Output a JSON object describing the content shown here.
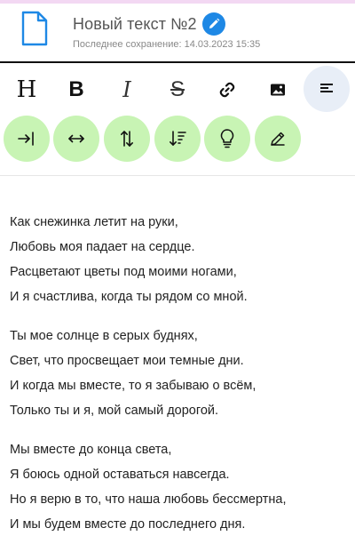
{
  "document": {
    "title": "Новый текст №2",
    "last_saved": "Последнее сохранение: 14.03.2023 15:35"
  },
  "toolbar": {
    "row1": [
      {
        "name": "heading-tool",
        "glyph": "H",
        "kind": "text"
      },
      {
        "name": "bold-tool",
        "glyph": "B",
        "kind": "text"
      },
      {
        "name": "italic-tool",
        "glyph": "I",
        "kind": "text"
      },
      {
        "name": "strikethrough-tool",
        "glyph": "S",
        "kind": "text"
      },
      {
        "name": "link-tool",
        "icon": "link-icon",
        "kind": "icon"
      },
      {
        "name": "image-tool",
        "icon": "image-icon",
        "kind": "icon"
      },
      {
        "name": "align-left-tool",
        "icon": "align-left-icon",
        "kind": "icon",
        "active": true
      }
    ],
    "row2": [
      {
        "name": "indent-tool",
        "icon": "indent-arrow-icon"
      },
      {
        "name": "letter-spacing-tool",
        "icon": "horizontal-arrows-icon"
      },
      {
        "name": "line-spacing-tool",
        "icon": "vertical-arrows-icon"
      },
      {
        "name": "sort-tool",
        "icon": "sort-descending-icon"
      },
      {
        "name": "idea-tool",
        "icon": "lightbulb-icon"
      },
      {
        "name": "pen-tool",
        "icon": "pencil-icon"
      }
    ]
  },
  "colors": {
    "accent_blue": "#1e88e5",
    "tool_green": "#c8f4b4",
    "active_tool": "#e8eef7",
    "top_accent": "#f3d8f3"
  },
  "poem": {
    "stanzas": [
      {
        "lines": [
          "Как снежинка летит на руки,",
          "Любовь моя падает на сердце.",
          "Расцветают цветы под моими ногами,",
          "И я счастлива, когда ты рядом со мной."
        ]
      },
      {
        "lines": [
          "Ты мое солнце в серых буднях,",
          "Свет, что просвещает мои темные дни.",
          "И когда мы вместе, то я забываю о всём,",
          "Только ты и я, мой самый дорогой."
        ]
      },
      {
        "lines": [
          "Мы вместе до конца света,",
          "Я боюсь одной оставаться навсегда.",
          "Но я верю в то, что наша любовь бессмертна,",
          "И мы будем вместе до последнего дня."
        ]
      }
    ]
  }
}
